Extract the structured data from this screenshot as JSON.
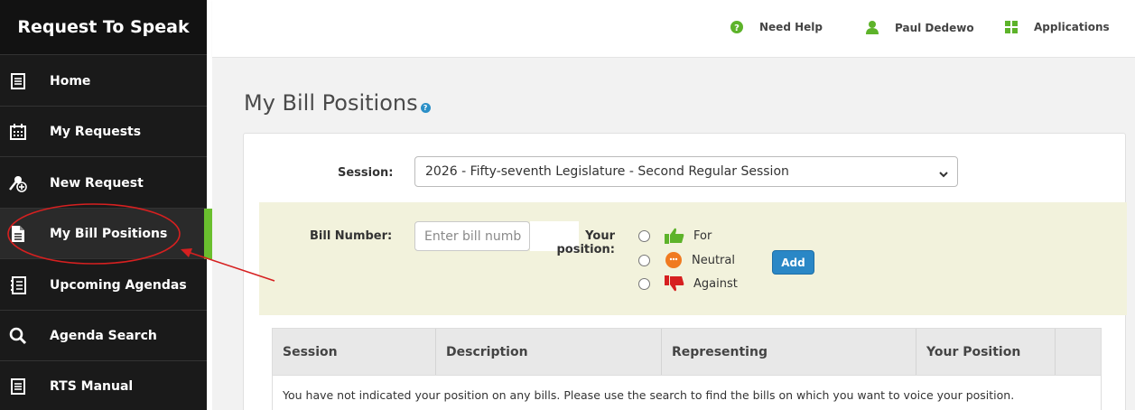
{
  "sidebar": {
    "title": "Request To Speak",
    "items": [
      {
        "label": "Home",
        "icon": "document-icon"
      },
      {
        "label": "My Requests",
        "icon": "calendar-icon"
      },
      {
        "label": "New Request",
        "icon": "microphone-add-icon"
      },
      {
        "label": "My Bill Positions",
        "icon": "file-icon"
      },
      {
        "label": "Upcoming Agendas",
        "icon": "agenda-icon"
      },
      {
        "label": "Agenda Search",
        "icon": "search-icon"
      },
      {
        "label": "RTS Manual",
        "icon": "manual-icon"
      }
    ],
    "active_item": "My Bill Positions"
  },
  "topbar": {
    "help_label": "Need Help",
    "user_label": "Paul Dedewo",
    "apps_label": "Applications"
  },
  "page": {
    "title": "My Bill Positions",
    "help_icon_text": "?"
  },
  "form": {
    "session_label": "Session:",
    "session_value": "2026 - Fifty-seventh Legislature - Second Regular Session",
    "bill_number_label": "Bill Number:",
    "bill_number_placeholder": "Enter bill numb",
    "position_label_line1": "Your",
    "position_label_line2": "position:",
    "options": [
      {
        "label": "For",
        "icon": "thumbs-up-icon"
      },
      {
        "label": "Neutral",
        "icon": "neutral-face-icon"
      },
      {
        "label": "Against",
        "icon": "thumbs-down-icon"
      }
    ],
    "add_label": "Add"
  },
  "table": {
    "columns": [
      "Session",
      "Description",
      "Representing",
      "Your Position",
      ""
    ],
    "empty_message": "You have not indicated your position on any bills. Please use the search to find the bills on which you want to voice your position."
  },
  "colors": {
    "sidebar_bg": "#1a1a1a",
    "accent_green": "#6abf2e",
    "band_bg": "#f2f2dc",
    "add_button": "#2a87c6",
    "annotation_red": "#d62020"
  }
}
